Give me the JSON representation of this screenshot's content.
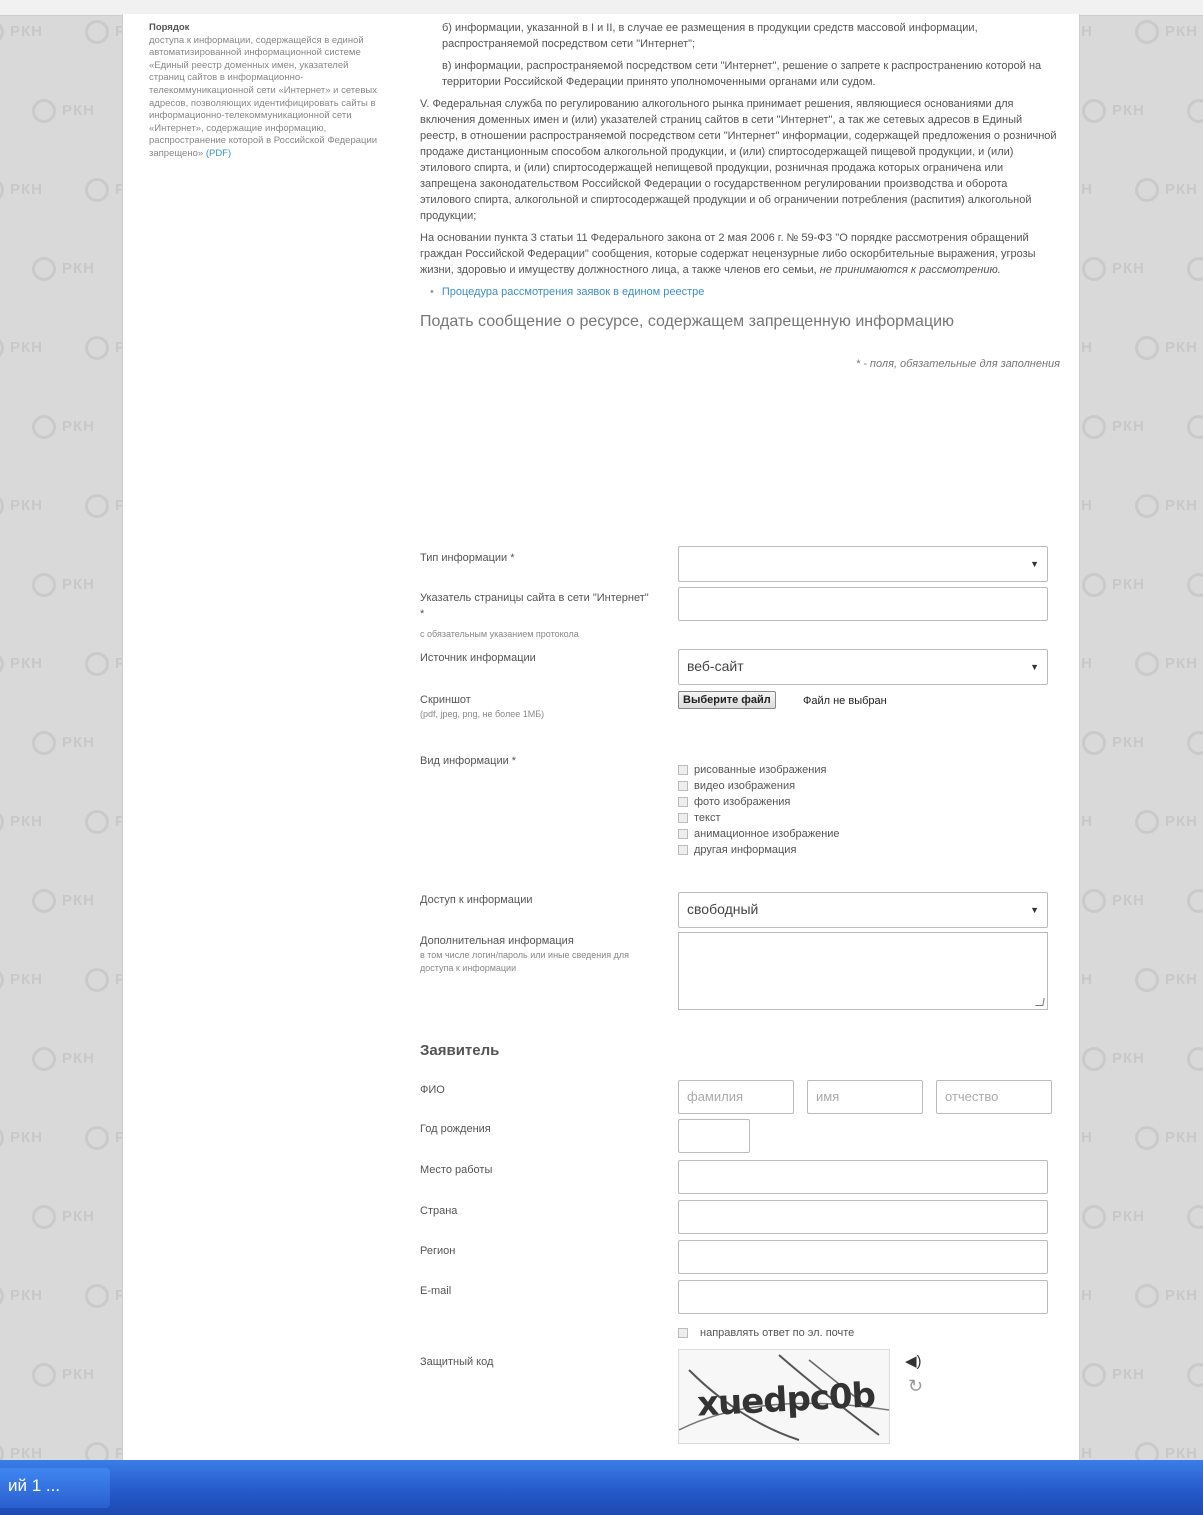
{
  "sidebar": {
    "title": "Порядок",
    "text": "доступа к информации, содержащейся в единой автоматизированной информационной системе «Единый реестр доменных имен, указателей страниц сайтов в информационно-телекоммуникационной сети «Интернет» и сетевых адресов, позволяющих идентифицировать сайты в информационно-телекоммуникационной сети «Интернет», содержащие информацию, распространение которой в Российской Федерации запрещено»",
    "pdf_link": "(PDF)"
  },
  "content": {
    "item_b": "б) информации, указанной в I и II, в случае ее размещения в продукции средств массовой информации, распространяемой посредством сети \"Интернет\";",
    "item_v": "в) информации, распространяемой посредством сети \"Интернет\", решение о запрете к распространению которой на территории Российской Федерации принято уполномоченными органами или судом.",
    "para_v": "V. Федеральная служба по регулированию алкогольного рынка принимает решения, являющиеся основаниями для включения доменных имен и (или) указателей страниц сайтов в сети \"Интернет\", а так же сетевых адресов в Единый реестр, в отношении распространяемой посредством сети \"Интернет\" информации, содержащей предложения о розничной продаже дистанционным способом алкогольной продукции, и (или) спиртосодержащей пищевой продукции, и (или) этилового спирта, и (или) спиртосодержащей непищевой продукции, розничная продажа которых ограничена или запрещена законодательством Российской Федерации о государственном регулировании производства и оборота этилового спирта, алкогольной и спиртосодержащей продукции и об ограничении потребления (распития) алкогольной продукции;",
    "para_law": "На основании пункта 3 статьи 11 Федерального закона от 2 мая 2006 г. № 59-ФЗ \"О порядке рассмотрения обращений граждан Российской Федерации\" сообщения, которые содержат нецензурные либо оскорбительные выражения, угрозы жизни, здоровью и имуществу должностного лица, а также членов его семьи,",
    "para_law_em": "не принимаются к рассмотрению.",
    "procedure_link": "Процедура рассмотрения заявок в едином реестре",
    "form_heading": "Подать сообщение о ресурсе, содержащем запрещенную информацию",
    "required_note": "* - поля, обязательные для заполнения"
  },
  "form": {
    "info_type_label": "Тип информации *",
    "info_type_value": "",
    "url_label": "Указатель страницы сайта в сети \"Интернет\" *",
    "url_sub": "с обязательным указанием протокола",
    "source_label": "Источник информации",
    "source_value": "веб-сайт",
    "screenshot_label": "Скриншот",
    "screenshot_sub": "(pdf, jpeg, png, не более 1МБ)",
    "file_button": "Выберите файл",
    "file_status": "Файл не выбран",
    "kind_label": "Вид информации *",
    "kinds": [
      "рисованные изображения",
      "видео изображения",
      "фото изображения",
      "текст",
      "анимационное изображение",
      "другая информация"
    ],
    "access_label": "Доступ к информации",
    "access_value": "свободный",
    "extra_label": "Дополнительная информация",
    "extra_sub": "в том числе логин/пароль или иные сведения для доступа к информации",
    "applicant_heading": "Заявитель",
    "fio_label": "ФИО",
    "fio_placeholders": [
      "фамилия",
      "имя",
      "отчество"
    ],
    "birth_label": "Год рождения",
    "work_label": "Место работы",
    "country_label": "Страна",
    "region_label": "Регион",
    "email_label": "E-mail",
    "email_reply": "направлять ответ по эл. почте",
    "captcha_label": "Защитный код",
    "captcha_code": "xuedpc0b"
  },
  "taskbar": {
    "button_label": "ий 1 ..."
  },
  "watermark": "РКН",
  "colors": {
    "link": "#3b8fc7",
    "taskbar": "#2457c8",
    "background": "#d9d9d9"
  }
}
